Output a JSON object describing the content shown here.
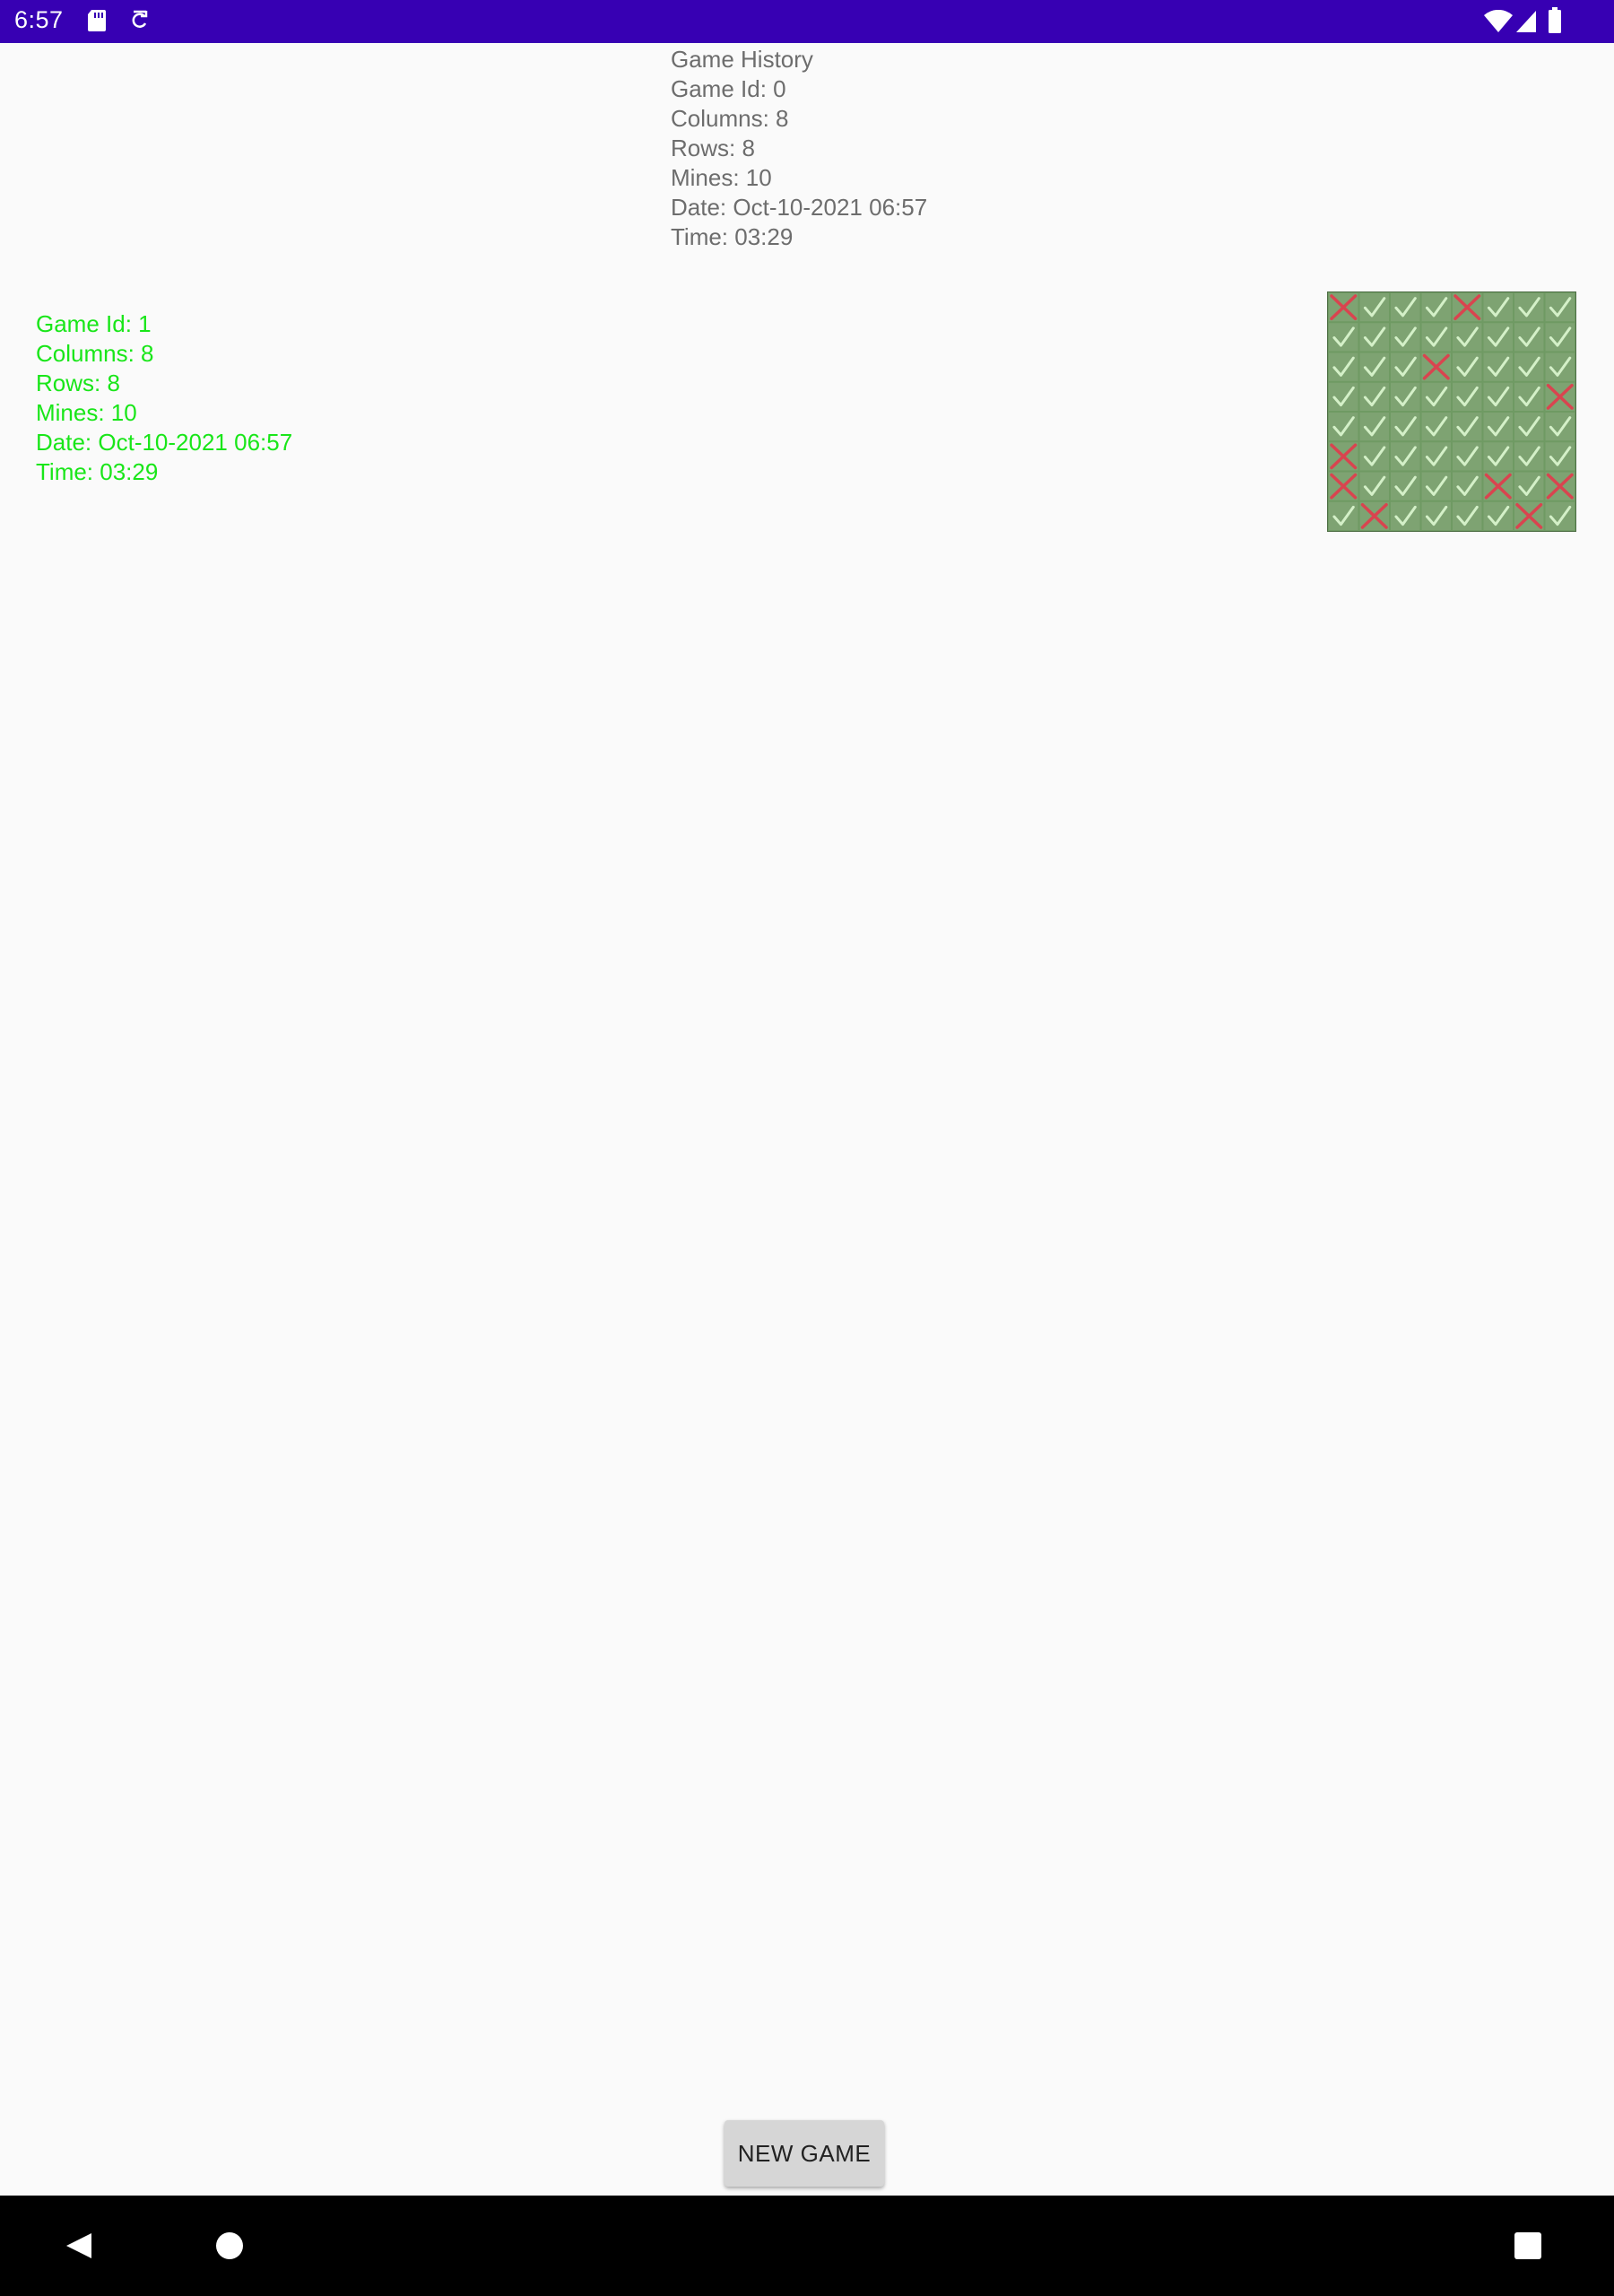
{
  "status_bar": {
    "time": "6:57",
    "left_icons": [
      "sd-card-icon",
      "sync-icon"
    ],
    "right_icons": [
      "wifi-icon",
      "cell-signal-icon",
      "battery-icon"
    ],
    "background_color": "#3700b3"
  },
  "history_header": {
    "title": "Game History",
    "game_id": "Game Id: 0",
    "columns": "Columns: 8",
    "rows": "Rows: 8",
    "mines": "Mines: 10",
    "date": "Date: Oct-10-2021 06:57",
    "time": "Time: 03:29",
    "text_color": "#6d6d6d"
  },
  "game_record": {
    "game_id": "Game Id: 1",
    "columns": "Columns: 8",
    "rows": "Rows: 8",
    "mines": "Mines: 10",
    "date": "Date: Oct-10-2021 06:57",
    "time": "Time: 03:29",
    "text_color": "#19e619"
  },
  "board_thumbnail": {
    "columns": 8,
    "rows": 8,
    "cells": [
      [
        "x",
        "c",
        "c",
        "c",
        "x",
        "c",
        "c",
        "c"
      ],
      [
        "c",
        "c",
        "c",
        "c",
        "c",
        "c",
        "c",
        "c"
      ],
      [
        "c",
        "c",
        "c",
        "x",
        "c",
        "c",
        "c",
        "c"
      ],
      [
        "c",
        "c",
        "c",
        "c",
        "c",
        "c",
        "c",
        "x"
      ],
      [
        "c",
        "c",
        "c",
        "c",
        "c",
        "c",
        "c",
        "c"
      ],
      [
        "x",
        "c",
        "c",
        "c",
        "c",
        "c",
        "c",
        "c"
      ],
      [
        "x",
        "c",
        "c",
        "c",
        "c",
        "x",
        "c",
        "x"
      ],
      [
        "c",
        "x",
        "c",
        "c",
        "c",
        "c",
        "x",
        "c"
      ]
    ],
    "cell_icons": {
      "c": "check-icon",
      "x": "mine-cross-icon"
    },
    "check_color": "#d4f0c8",
    "cross_color": "#d9444f",
    "background_color": "#6f9a63"
  },
  "actions": {
    "new_game_label": "NEW GAME"
  },
  "nav_bar": {
    "icons": [
      "back-icon",
      "home-icon",
      "recents-icon"
    ]
  }
}
